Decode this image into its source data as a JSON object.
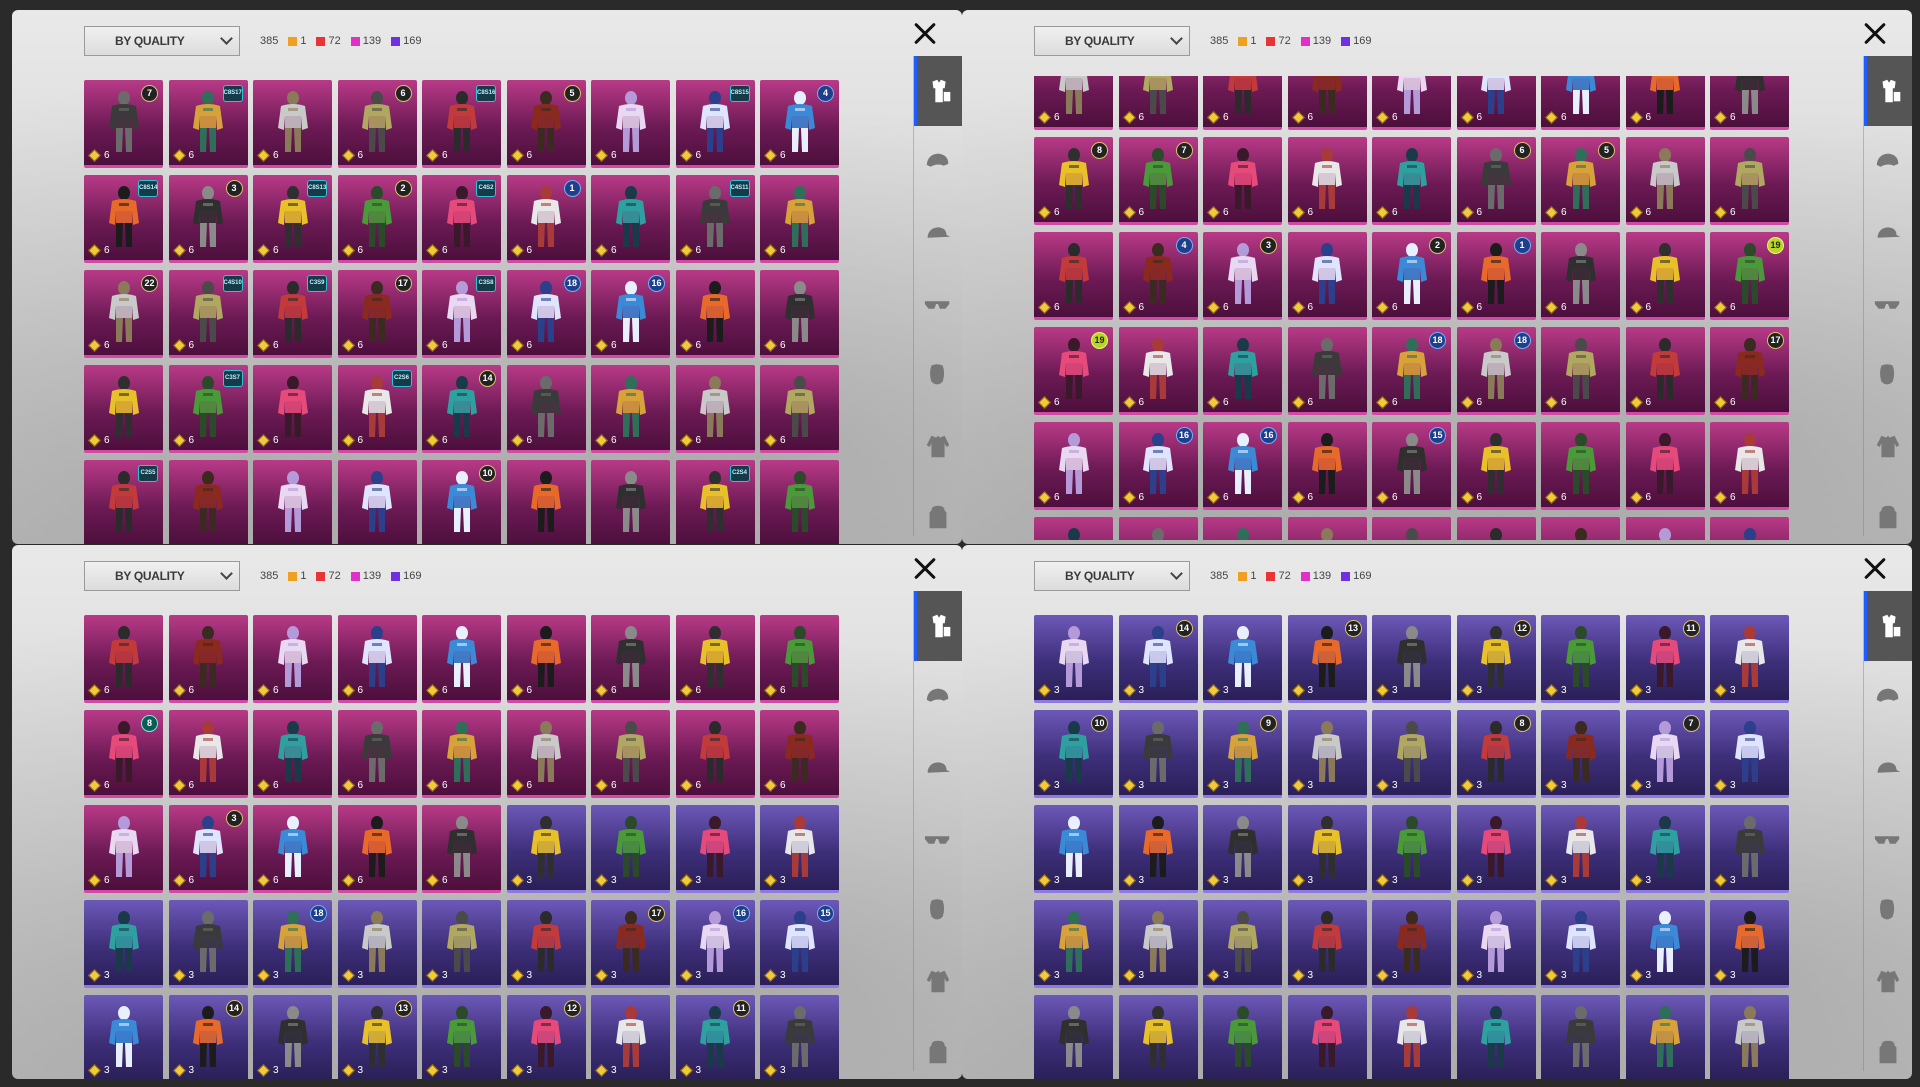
{
  "screens": [
    {
      "sort_label": "BY QUALITY",
      "total": "385",
      "legend": [
        {
          "color": "orange",
          "count": "1"
        },
        {
          "color": "red",
          "count": "72"
        },
        {
          "color": "pink",
          "count": "139"
        },
        {
          "color": "purple",
          "count": "169"
        }
      ],
      "grid": {
        "rows": 5,
        "cols": 9,
        "tiers": [
          "L",
          "L",
          "L",
          "L",
          "L"
        ],
        "qty": [
          "6",
          "6",
          "6",
          "6",
          ""
        ],
        "badges": {
          "0-0": "7",
          "0-1": "C8S17",
          "0-3": "6",
          "0-4": "C8S16",
          "0-5": "5",
          "0-7": "C8S15",
          "0-8": "4",
          "1-0": "C8S14",
          "1-1": "3",
          "1-2": "C8S13",
          "1-3": "2",
          "1-4": "C4S2",
          "1-5": "1",
          "1-7": "C4S11",
          "2-0": "22",
          "2-1": "C4S10",
          "2-2": "C3S9",
          "2-3": "17",
          "2-4": "C3S8",
          "2-5": "18",
          "2-6": "16",
          "3-1": "C3S7",
          "3-3": "C2S6",
          "3-4": "14",
          "4-0": "C2S5",
          "4-4": "10",
          "4-7": "C2S4"
        }
      },
      "tabs": [
        "outfit-icon",
        "helmet-icon",
        "cap-icon",
        "glasses-icon",
        "mask-icon",
        "jacket-icon",
        "backpack-icon"
      ]
    },
    {
      "sort_label": "BY QUALITY",
      "total": "385",
      "legend": [
        {
          "color": "orange",
          "count": "1"
        },
        {
          "color": "red",
          "count": "72"
        },
        {
          "color": "pink",
          "count": "139"
        },
        {
          "color": "purple",
          "count": "169"
        }
      ],
      "grid": {
        "rows": 6,
        "cols": 9,
        "tiers": [
          "L",
          "L",
          "L",
          "L",
          "L",
          "L"
        ],
        "qty": [
          "6",
          "6",
          "6",
          "6",
          "6",
          ""
        ],
        "badges": {
          "1-0": "8",
          "1-1": "7",
          "1-5": "6",
          "1-6": "5",
          "2-1": "4",
          "2-2": "3",
          "2-4": "2",
          "2-5": "1",
          "2-8": "19",
          "3-0": "19",
          "3-4": "18",
          "3-5": "18",
          "3-8": "17",
          "4-1": "16",
          "4-2": "16",
          "4-4": "15"
        }
      },
      "tabs": [
        "outfit-icon",
        "helmet-icon",
        "cap-icon",
        "glasses-icon",
        "mask-icon",
        "jacket-icon",
        "backpack-icon"
      ]
    },
    {
      "sort_label": "BY QUALITY",
      "total": "385",
      "legend": [
        {
          "color": "orange",
          "count": "1"
        },
        {
          "color": "red",
          "count": "72"
        },
        {
          "color": "pink",
          "count": "139"
        },
        {
          "color": "purple",
          "count": "169"
        }
      ],
      "grid": {
        "rows": 5,
        "cols": 9,
        "tiers": [
          "L",
          "L",
          "M",
          "E",
          "E"
        ],
        "qty": [
          "6",
          "6",
          "M",
          "3",
          "3"
        ],
        "badges": {
          "1-0": "8",
          "2-1": "3",
          "3-2": "18",
          "3-6": "17",
          "3-7": "16",
          "3-8": "15",
          "4-1": "14",
          "4-3": "13",
          "4-5": "12",
          "4-7": "11"
        }
      },
      "tabs": [
        "outfit-icon",
        "helmet-icon",
        "cap-icon",
        "glasses-icon",
        "mask-icon",
        "jacket-icon",
        "backpack-icon"
      ]
    },
    {
      "sort_label": "BY QUALITY",
      "total": "385",
      "legend": [
        {
          "color": "orange",
          "count": "1"
        },
        {
          "color": "red",
          "count": "72"
        },
        {
          "color": "pink",
          "count": "139"
        },
        {
          "color": "purple",
          "count": "169"
        }
      ],
      "grid": {
        "rows": 5,
        "cols": 9,
        "tiers": [
          "E",
          "E",
          "E",
          "E",
          "E"
        ],
        "qty": [
          "3",
          "3",
          "3",
          "3",
          ""
        ],
        "badges": {
          "0-1": "14",
          "0-3": "13",
          "0-5": "12",
          "0-7": "11",
          "1-0": "10",
          "1-2": "9",
          "1-5": "8",
          "1-7": "7"
        }
      },
      "tabs": [
        "outfit-icon",
        "helmet-icon",
        "cap-icon",
        "glasses-icon",
        "mask-icon",
        "jacket-icon",
        "backpack-icon"
      ]
    }
  ]
}
